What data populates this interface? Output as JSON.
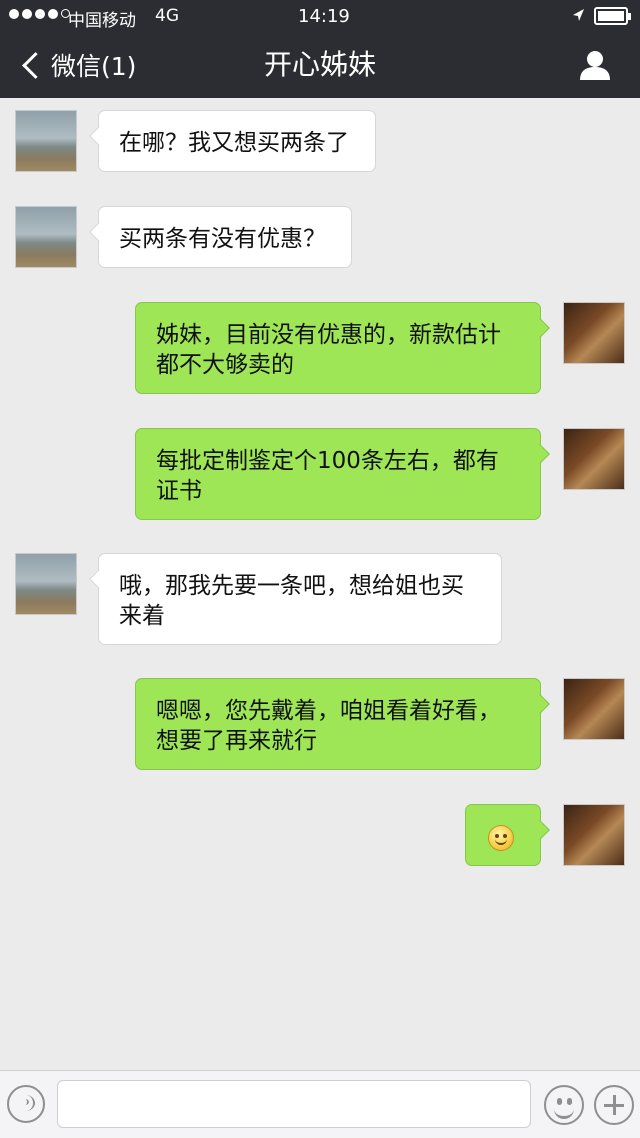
{
  "status_bar": {
    "carrier": "中国移动",
    "network": "4G",
    "time": "14:19",
    "signal_icon": "signal-dots-icon",
    "location_icon": "location-arrow-icon",
    "battery_icon": "battery-icon"
  },
  "nav": {
    "back_label": "微信(1)",
    "title": "开心姊妹",
    "profile_icon": "person-icon"
  },
  "messages": [
    {
      "side": "left",
      "text": "在哪？我又想买两条了"
    },
    {
      "side": "left",
      "text": "买两条有没有优惠？"
    },
    {
      "side": "right",
      "text": "姊妹，目前没有优惠的，新款估计都不大够卖的"
    },
    {
      "side": "right",
      "text": "每批定制鉴定个100条左右，都有证书"
    },
    {
      "side": "left",
      "text": "哦，那我先要一条吧，想给姐也买来着"
    },
    {
      "side": "right",
      "text": "嗯嗯，您先戴着，咱姐看着好看，想要了再来就行"
    },
    {
      "side": "right",
      "type": "emoji",
      "emoji": "smile-emoji"
    }
  ],
  "input_bar": {
    "voice_icon": "voice-icon",
    "text_value": "",
    "emoji_icon": "emoji-icon",
    "plus_icon": "plus-icon"
  },
  "colors": {
    "nav_bg": "#2c2d32",
    "chat_bg": "#ebebeb",
    "sent_bubble": "#9fe657",
    "received_bubble": "#ffffff"
  }
}
